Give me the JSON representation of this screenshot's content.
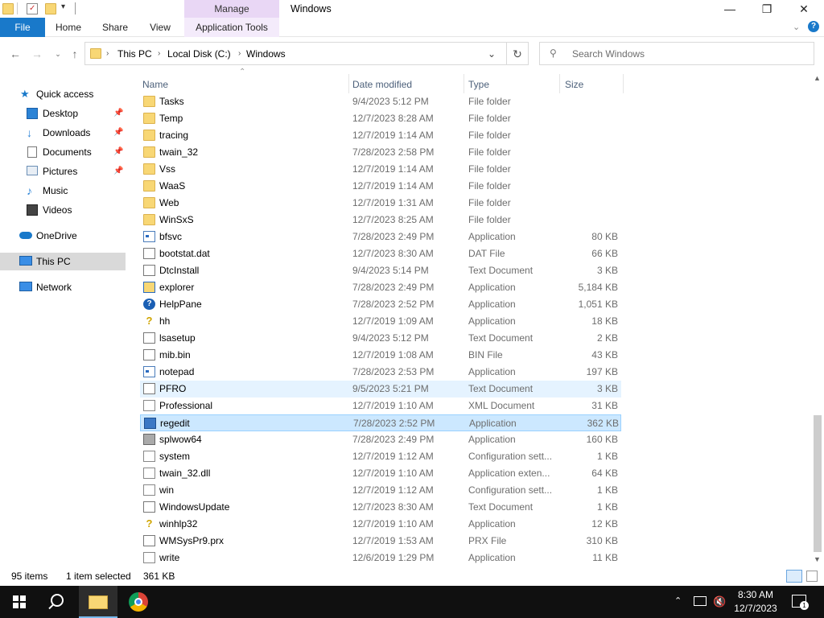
{
  "window": {
    "manage_label": "Manage",
    "title": "Windows",
    "minimize": "—",
    "maximize": "❐",
    "close": "✕"
  },
  "ribbon": {
    "tabs": [
      "File",
      "Home",
      "Share",
      "View",
      "Application Tools"
    ]
  },
  "address": {
    "crumbs": [
      "This PC",
      "Local Disk (C:)",
      "Windows"
    ],
    "search_placeholder": "Search Windows"
  },
  "nav": {
    "items": [
      {
        "label": "Quick access",
        "icon": "star-icon"
      },
      {
        "label": "Desktop",
        "icon": "desktop-icon",
        "pinned": true
      },
      {
        "label": "Downloads",
        "icon": "download-icon",
        "pinned": true
      },
      {
        "label": "Documents",
        "icon": "documents-icon",
        "pinned": true
      },
      {
        "label": "Pictures",
        "icon": "pictures-icon",
        "pinned": true
      },
      {
        "label": "Music",
        "icon": "music-icon"
      },
      {
        "label": "Videos",
        "icon": "videos-icon"
      },
      {
        "label": "OneDrive",
        "icon": "cloud-icon"
      },
      {
        "label": "This PC",
        "icon": "computer-icon",
        "selected": true
      },
      {
        "label": "Network",
        "icon": "network-icon"
      }
    ]
  },
  "columns": {
    "name": "Name",
    "date": "Date modified",
    "type": "Type",
    "size": "Size"
  },
  "files": [
    {
      "name": "Tasks",
      "date": "9/4/2023 5:12 PM",
      "type": "File folder",
      "size": "",
      "icon": "folder"
    },
    {
      "name": "Temp",
      "date": "12/7/2023 8:28 AM",
      "type": "File folder",
      "size": "",
      "icon": "folder"
    },
    {
      "name": "tracing",
      "date": "12/7/2019 1:14 AM",
      "type": "File folder",
      "size": "",
      "icon": "folder"
    },
    {
      "name": "twain_32",
      "date": "7/28/2023 2:58 PM",
      "type": "File folder",
      "size": "",
      "icon": "folder"
    },
    {
      "name": "Vss",
      "date": "12/7/2019 1:14 AM",
      "type": "File folder",
      "size": "",
      "icon": "folder"
    },
    {
      "name": "WaaS",
      "date": "12/7/2019 1:14 AM",
      "type": "File folder",
      "size": "",
      "icon": "folder"
    },
    {
      "name": "Web",
      "date": "12/7/2019 1:31 AM",
      "type": "File folder",
      "size": "",
      "icon": "folder"
    },
    {
      "name": "WinSxS",
      "date": "12/7/2023 8:25 AM",
      "type": "File folder",
      "size": "",
      "icon": "folder"
    },
    {
      "name": "bfsvc",
      "date": "7/28/2023 2:49 PM",
      "type": "Application",
      "size": "80 KB",
      "icon": "app"
    },
    {
      "name": "bootstat.dat",
      "date": "12/7/2023 8:30 AM",
      "type": "DAT File",
      "size": "66 KB",
      "icon": "doc"
    },
    {
      "name": "DtcInstall",
      "date": "9/4/2023 5:14 PM",
      "type": "Text Document",
      "size": "3 KB",
      "icon": "doc"
    },
    {
      "name": "explorer",
      "date": "7/28/2023 2:49 PM",
      "type": "Application",
      "size": "5,184 KB",
      "icon": "explorer"
    },
    {
      "name": "HelpPane",
      "date": "7/28/2023 2:52 PM",
      "type": "Application",
      "size": "1,051 KB",
      "icon": "help"
    },
    {
      "name": "hh",
      "date": "12/7/2019 1:09 AM",
      "type": "Application",
      "size": "18 KB",
      "icon": "q"
    },
    {
      "name": "lsasetup",
      "date": "9/4/2023 5:12 PM",
      "type": "Text Document",
      "size": "2 KB",
      "icon": "doc"
    },
    {
      "name": "mib.bin",
      "date": "12/7/2019 1:08 AM",
      "type": "BIN File",
      "size": "43 KB",
      "icon": "doc"
    },
    {
      "name": "notepad",
      "date": "7/28/2023 2:53 PM",
      "type": "Application",
      "size": "197 KB",
      "icon": "app"
    },
    {
      "name": "PFRO",
      "date": "9/5/2023 5:21 PM",
      "type": "Text Document",
      "size": "3 KB",
      "icon": "doc",
      "hover": true
    },
    {
      "name": "Professional",
      "date": "12/7/2019 1:10 AM",
      "type": "XML Document",
      "size": "31 KB",
      "icon": "cfg"
    },
    {
      "name": "regedit",
      "date": "7/28/2023 2:52 PM",
      "type": "Application",
      "size": "362 KB",
      "icon": "regedit",
      "selected": true
    },
    {
      "name": "splwow64",
      "date": "7/28/2023 2:49 PM",
      "type": "Application",
      "size": "160 KB",
      "icon": "print"
    },
    {
      "name": "system",
      "date": "12/7/2019 1:12 AM",
      "type": "Configuration sett...",
      "size": "1 KB",
      "icon": "cfg"
    },
    {
      "name": "twain_32.dll",
      "date": "12/7/2019 1:10 AM",
      "type": "Application exten...",
      "size": "64 KB",
      "icon": "cfg"
    },
    {
      "name": "win",
      "date": "12/7/2019 1:12 AM",
      "type": "Configuration sett...",
      "size": "1 KB",
      "icon": "cfg"
    },
    {
      "name": "WindowsUpdate",
      "date": "12/7/2023 8:30 AM",
      "type": "Text Document",
      "size": "1 KB",
      "icon": "doc"
    },
    {
      "name": "winhlp32",
      "date": "12/7/2019 1:10 AM",
      "type": "Application",
      "size": "12 KB",
      "icon": "q"
    },
    {
      "name": "WMSysPr9.prx",
      "date": "12/7/2019 1:53 AM",
      "type": "PRX File",
      "size": "310 KB",
      "icon": "doc"
    },
    {
      "name": "write",
      "date": "12/6/2019 1:29 PM",
      "type": "Application",
      "size": "11 KB",
      "icon": "cfg"
    }
  ],
  "status": {
    "item_count": "95 items",
    "selection": "1 item selected",
    "selection_size": "361 KB"
  },
  "taskbar": {
    "time": "8:30 AM",
    "date": "12/7/2023"
  }
}
